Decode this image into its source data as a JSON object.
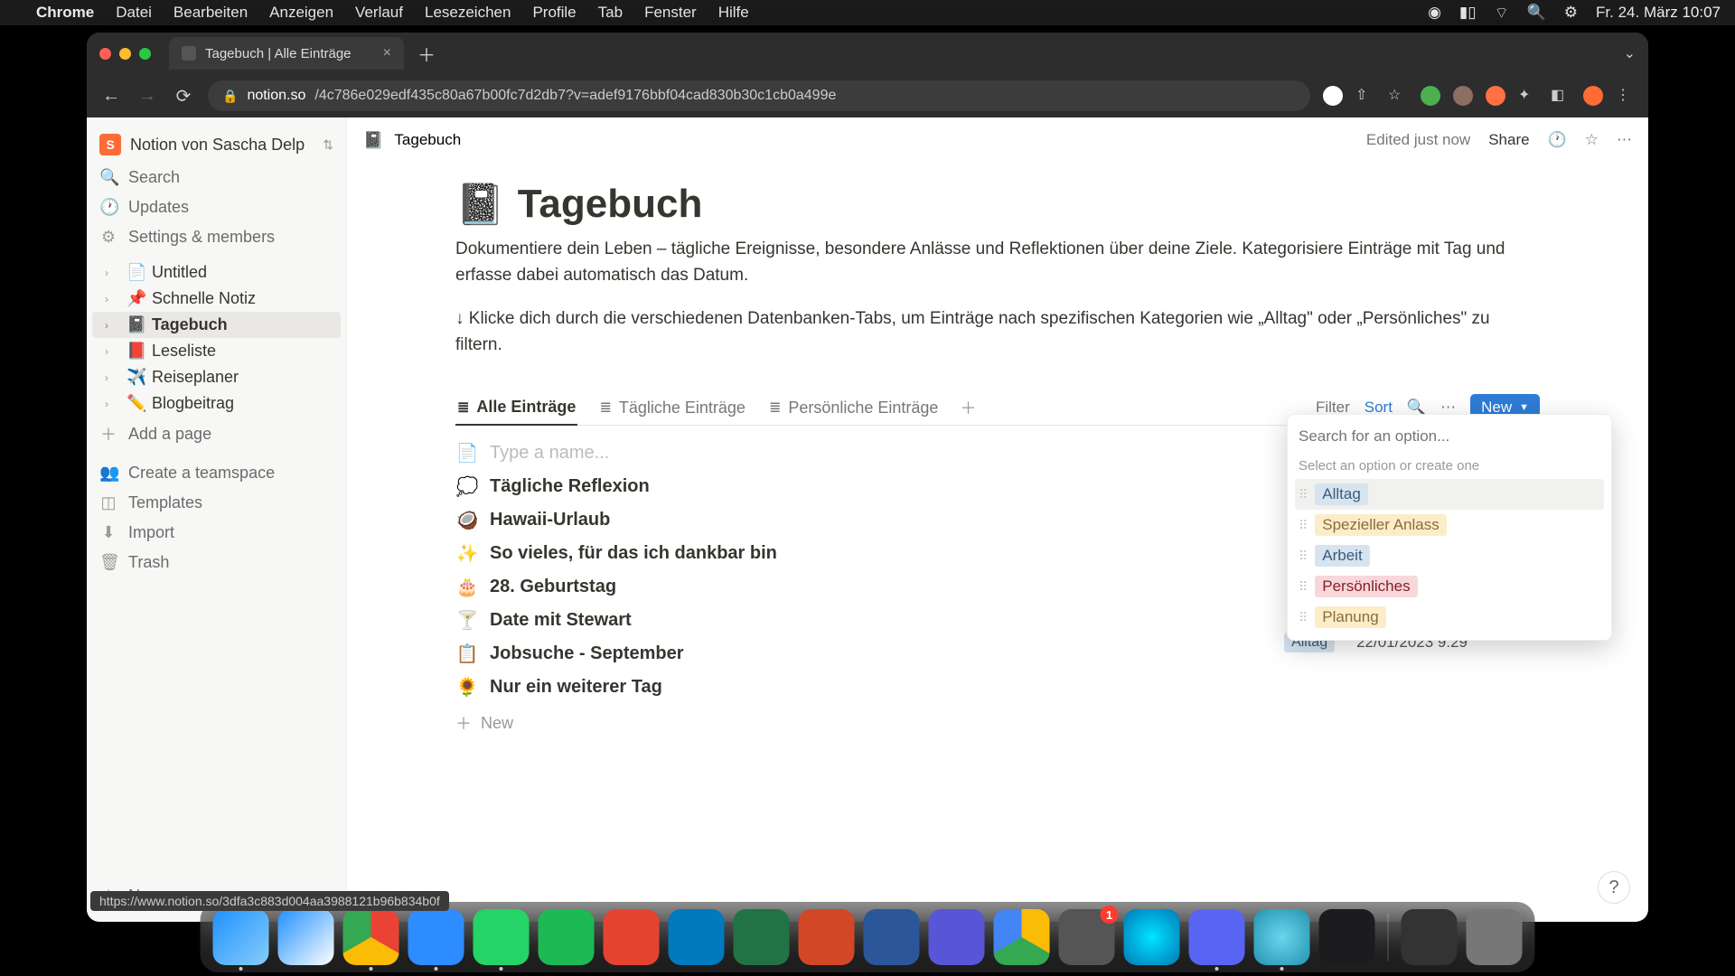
{
  "menubar": {
    "app": "Chrome",
    "items": [
      "Datei",
      "Bearbeiten",
      "Anzeigen",
      "Verlauf",
      "Lesezeichen",
      "Profile",
      "Tab",
      "Fenster",
      "Hilfe"
    ],
    "clock": "Fr. 24. März  10:07"
  },
  "browser": {
    "tab_title": "Tagebuch | Alle Einträge",
    "url_host": "notion.so",
    "url_path": "/4c786e029edf435c80a67b00fc7d2db7?v=adef9176bbf04cad830b30c1cb0a499e"
  },
  "workspace": {
    "name": "Notion von Sascha Delp",
    "initial": "S"
  },
  "sidebar": {
    "search": "Search",
    "updates": "Updates",
    "settings": "Settings & members",
    "pages": [
      {
        "emoji": "📄",
        "label": "Untitled"
      },
      {
        "emoji": "📌",
        "label": "Schnelle Notiz"
      },
      {
        "emoji": "📓",
        "label": "Tagebuch",
        "active": true
      },
      {
        "emoji": "📕",
        "label": "Leseliste"
      },
      {
        "emoji": "✈️",
        "label": "Reiseplaner"
      },
      {
        "emoji": "✏️",
        "label": "Blogbeitrag"
      }
    ],
    "add_page": "Add a page",
    "teamspace": "Create a teamspace",
    "templates": "Templates",
    "import": "Import",
    "trash": "Trash",
    "new_page": "New page"
  },
  "url_preview": "https://www.notion.so/3dfa3c883d004aa3988121b96b834b0f",
  "topbar": {
    "crumb_emoji": "📓",
    "crumb": "Tagebuch",
    "edited": "Edited just now",
    "share": "Share"
  },
  "page": {
    "emoji": "📓",
    "title": "Tagebuch",
    "desc1": "Dokumentiere dein Leben – tägliche Ereignisse, besondere Anlässe und Reflektionen über deine Ziele. Kategorisiere Einträge mit Tag und erfasse dabei automatisch das Datum.",
    "desc2": "↓ Klicke dich durch die verschiedenen Datenbanken-Tabs, um Einträge nach spezifischen Kategorien wie „Alltag\" oder „Persönliches\" zu filtern."
  },
  "db": {
    "tabs": [
      {
        "icon": "≣",
        "label": "Alle Einträge",
        "active": true
      },
      {
        "icon": "≣",
        "label": "Tägliche Einträge"
      },
      {
        "icon": "≣",
        "label": "Persönliche Einträge"
      }
    ],
    "filter": "Filter",
    "sort": "Sort",
    "newbtn": "New",
    "entries": [
      {
        "emoji": "📄",
        "title": "Type a name...",
        "placeholder": true
      },
      {
        "emoji": "💭",
        "title": "Tägliche Reflexion"
      },
      {
        "emoji": "🥥",
        "title": "Hawaii-Urlaub"
      },
      {
        "emoji": "✨",
        "title": "So vieles, für das ich dankbar bin"
      },
      {
        "emoji": "🎂",
        "title": "28. Geburtstag"
      },
      {
        "emoji": "🍸",
        "title": "Date mit Stewart"
      },
      {
        "emoji": "📋",
        "title": "Jobsuche - September"
      },
      {
        "emoji": "🌻",
        "title": "Nur ein weiterer Tag"
      }
    ],
    "newrow": "New",
    "tag_hint": "Spe",
    "last_tag": "Alltag",
    "last_date": "22/01/2023 9:29"
  },
  "dropdown": {
    "placeholder": "Search for an option...",
    "hint": "Select an option or create one",
    "options": [
      {
        "label": "Alltag",
        "color": "c-alltag",
        "hl": true
      },
      {
        "label": "Spezieller Anlass",
        "color": "c-spez"
      },
      {
        "label": "Arbeit",
        "color": "c-arbeit"
      },
      {
        "label": "Persönliches",
        "color": "c-pers"
      },
      {
        "label": "Planung",
        "color": "c-plan"
      }
    ]
  },
  "dock": {
    "apps": [
      {
        "name": "finder",
        "bg": "linear-gradient(135deg,#1e90ff,#87cefa)",
        "running": true
      },
      {
        "name": "safari",
        "bg": "linear-gradient(135deg,#1e90ff,#fff)"
      },
      {
        "name": "chrome",
        "bg": "conic-gradient(#ea4335 0 120deg,#fbbc05 120deg 240deg,#34a853 240deg)",
        "running": true
      },
      {
        "name": "zoom",
        "bg": "#2d8cff",
        "running": true
      },
      {
        "name": "whatsapp",
        "bg": "#25d366",
        "running": true
      },
      {
        "name": "spotify",
        "bg": "#1db954"
      },
      {
        "name": "todoist",
        "bg": "#e44332"
      },
      {
        "name": "trello",
        "bg": "#0079bf"
      },
      {
        "name": "excel",
        "bg": "#217346"
      },
      {
        "name": "powerpoint",
        "bg": "#d24726"
      },
      {
        "name": "word",
        "bg": "#2b579a"
      },
      {
        "name": "imovie",
        "bg": "#5856d6"
      },
      {
        "name": "drive",
        "bg": "conic-gradient(#fbbc05 0 120deg,#34a853 120deg 240deg,#4285f4 240deg)"
      },
      {
        "name": "settings",
        "bg": "#555",
        "badge": "1"
      },
      {
        "name": "siri",
        "bg": "radial-gradient(circle,#00e5ff,#0077b6)"
      },
      {
        "name": "discord",
        "bg": "#5865f2",
        "running": true
      },
      {
        "name": "quicktime",
        "bg": "radial-gradient(circle,#6dd5ed,#2193b0)",
        "running": true
      },
      {
        "name": "voice",
        "bg": "#1c1c1e"
      }
    ],
    "right": [
      {
        "name": "launchpad",
        "bg": "#333"
      },
      {
        "name": "trash",
        "bg": "#777"
      }
    ]
  }
}
